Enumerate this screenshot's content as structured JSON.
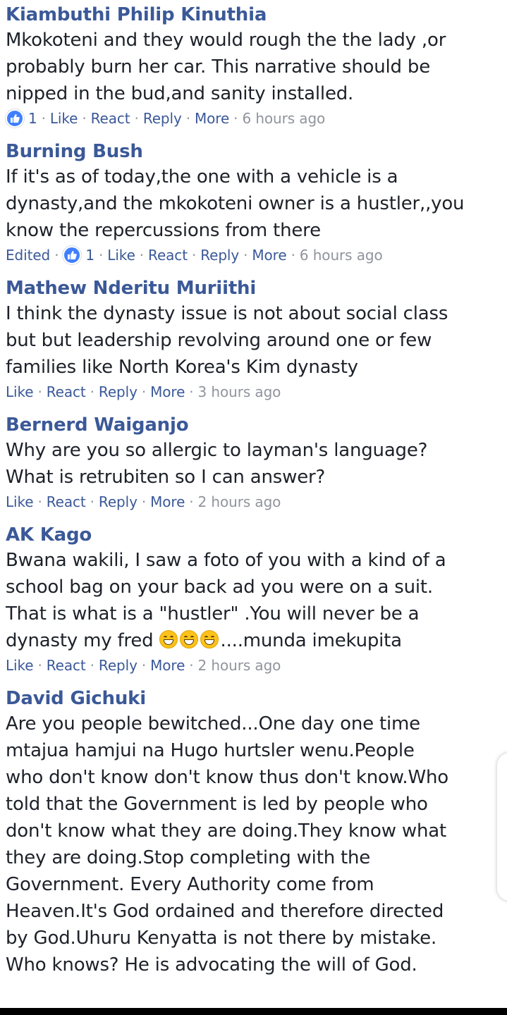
{
  "actions_labels": {
    "like": "Like",
    "react": "React",
    "reply": "Reply",
    "more": "More",
    "edited": "Edited",
    "separator": "·"
  },
  "comments": [
    {
      "author": "Kiambuthi Philip Kinuthia",
      "lines": [
        "Mkokoteni and they would rough the the lady ,or",
        "probably burn her car. This narrative should be",
        "nipped in the bud,and sanity installed."
      ],
      "like_count": "1",
      "time": "6 hours ago"
    },
    {
      "author": "Burning Bush",
      "lines": [
        "If it's as of today,the one with a vehicle is a",
        "dynasty,and the mkokoteni owner is a hustler,,you",
        "know the repercussions from there"
      ],
      "like_count": "1",
      "time": "6 hours ago"
    },
    {
      "author": "Mathew Nderitu Muriithi",
      "lines": [
        "I think the dynasty issue is not about social class",
        "but but leadership revolving around one or few",
        "families like North Korea's Kim dynasty"
      ],
      "time": "3 hours ago"
    },
    {
      "author": "Bernerd Waiganjo",
      "lines": [
        "Why are you so allergic to layman's language?",
        "What is retrubiten so I can answer?"
      ],
      "time": "2 hours ago"
    },
    {
      "author": "AK Kago",
      "lines": [
        "Bwana wakili, I saw a foto of you with a kind of a",
        "school bag on your back ad you were on a suit.",
        "That is what is a \"hustler\" .You will never be a"
      ],
      "last_line_prefix": "dynasty my fred ",
      "last_line_suffix": "....munda imekupita",
      "time": "2 hours ago"
    },
    {
      "author": "David Gichuki",
      "lines": [
        "Are you people bewitched...One day one time",
        "mtajua hamjui na Hugo hurtsler wenu.People",
        "who don't know don't know thus don't know.Who",
        "told that the Government is led by people who",
        "don't know what they are doing.They know what",
        "they are doing.Stop completing with the",
        "Government. Every Authority come from",
        "Heaven.It's God ordained and therefore directed",
        "by God.Uhuru Kenyatta is not there by mistake.",
        "Who knows? He is advocating the will of God."
      ]
    }
  ],
  "colors": {
    "author": "#3b5998",
    "body_text": "#1d2129",
    "meta": "#90949c",
    "like_badge": "#4080ff"
  },
  "icons": {
    "like_badge": "thumbs-up-icon",
    "emoji": "grinning-face-icon"
  }
}
